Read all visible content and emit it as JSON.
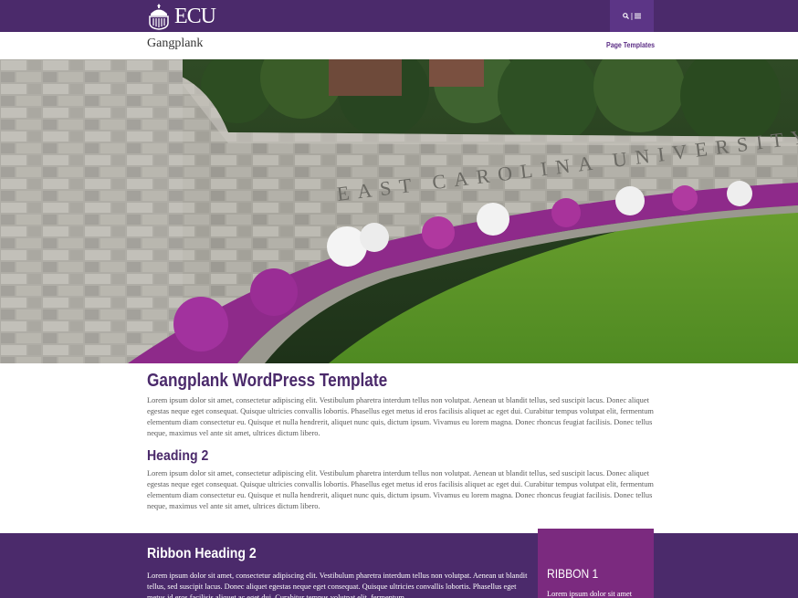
{
  "header": {
    "logo_text": "ECU",
    "site_name": "Gangplank",
    "toolbar_icons": [
      "search-icon",
      "menu-icon"
    ],
    "toolbar_separator": "|",
    "nav_link": "Page Templates"
  },
  "main": {
    "title": "Gangplank WordPress Template",
    "intro": "Lorem ipsum dolor sit amet, consectetur adipiscing elit. Vestibulum pharetra interdum tellus non volutpat. Aenean ut blandit tellus, sed suscipit lacus. Donec aliquet egestas neque eget consequat. Quisque ultricies convallis lobortis. Phasellus eget metus id eros facilisis aliquet ac eget dui. Curabitur tempus volutpat elit, fermentum elementum diam consectetur eu. Quisque et nulla hendrerit, aliquet nunc quis, dictum ipsum. Vivamus eu lorem magna. Donec rhoncus feugiat facilisis. Donec tellus neque, maximus vel ante sit amet, ultrices dictum libero.",
    "heading2": "Heading 2",
    "body2": "Lorem ipsum dolor sit amet, consectetur adipiscing elit. Vestibulum pharetra interdum tellus non volutpat. Aenean ut blandit tellus, sed suscipit lacus. Donec aliquet egestas neque eget consequat. Quisque ultricies convallis lobortis. Phasellus eget metus id eros facilisis aliquet ac eget dui. Curabitur tempus volutpat elit, fermentum elementum diam consectetur eu. Quisque et nulla hendrerit, aliquet nunc quis, dictum ipsum. Vivamus eu lorem magna. Donec rhoncus feugiat facilisis. Donec tellus neque, maximus vel ante sit amet, ultrices dictum libero."
  },
  "hero": {
    "engraving": "EAST CAROLINA UNIVERSITY"
  },
  "ribbon": {
    "heading": "Ribbon Heading 2",
    "text": "Lorem ipsum dolor sit amet, consectetur adipiscing elit. Vestibulum pharetra interdum tellus non volutpat. Aenean ut blandit tellus, sed suscipit lacus. Donec aliquet egestas neque eget consequat. Quisque ultricies convallis lobortis. Phasellus eget metus id eros facilisis aliquet ac eget dui. Curabitur tempus volutpat elit, fermentum",
    "box_title": "RIBBON 1",
    "box_text": "Lorem ipsum dolor sit amet"
  },
  "colors": {
    "brand_purple": "#4b2a6b",
    "toolbar_purple": "#5c3586",
    "ribbon_box": "#7b2a7f"
  }
}
